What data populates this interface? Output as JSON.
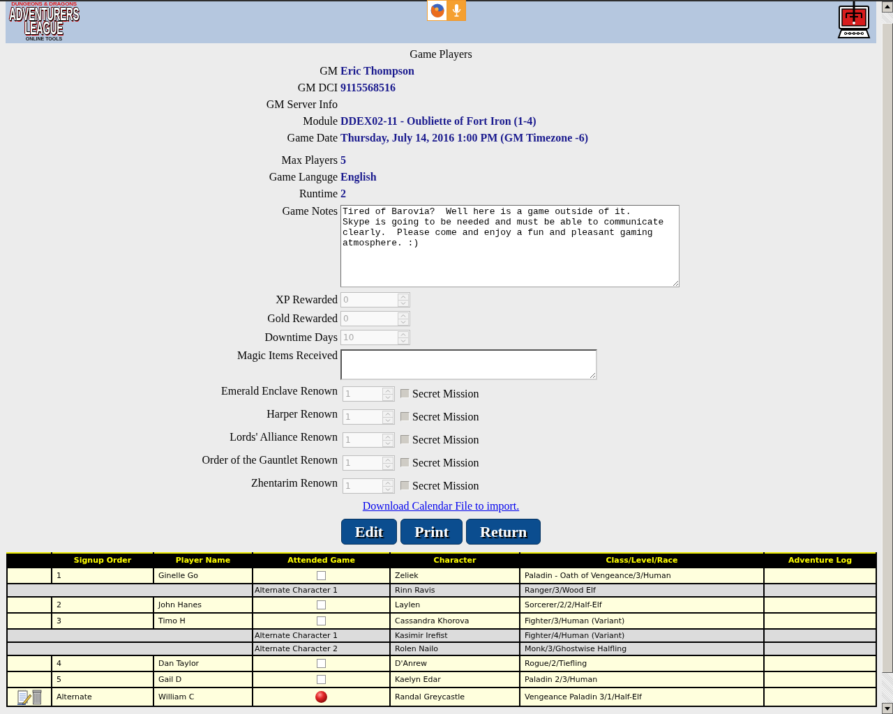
{
  "header": {
    "logo": {
      "brand": "DUNGEONS & DRAGONS",
      "title_line_1": "ADVENTURERS",
      "title_line_2": "LEAGUE",
      "tagline": "ONLINE TOOLS"
    }
  },
  "page_title": "Game Players",
  "details": [
    {
      "label": "GM",
      "value": "Eric Thompson"
    },
    {
      "label": "GM DCI",
      "value": "9115568516"
    },
    {
      "label": "GM Server Info"
    },
    {
      "label": "Module",
      "value": "DDEX02-11 - Oubliette of Fort Iron (1-4)"
    },
    {
      "label": "Game Date",
      "value": "Thursday, July 14, 2016 1:00 PM (GM Timezone -6)"
    }
  ],
  "game_info": [
    {
      "label": "Max Players",
      "value": "5"
    },
    {
      "label": "Game Languge",
      "value": "English"
    },
    {
      "label": "Runtime",
      "value": "2"
    }
  ],
  "game_notes": {
    "label": "Game Notes",
    "value": "Tired of Barovia?  Well here is a game outside of it.\nSkype is going to be needed and must be able to communicate\nclearly.  Please come and enjoy a fun and pleasant gaming\natmosphere. :)"
  },
  "rewards": [
    {
      "label": "XP Rewarded",
      "value": "0",
      "disabled": true
    },
    {
      "label": "Gold Rewarded",
      "value": "0",
      "disabled": true
    },
    {
      "label": "Downtime Days",
      "value": "10",
      "disabled": true
    }
  ],
  "magic_items": {
    "label": "Magic Items Received"
  },
  "renown": [
    {
      "label": "Emerald Enclave Renown",
      "value": "1",
      "disabled": true,
      "secret_mission": {
        "label": "Secret Mission",
        "checked": false
      }
    },
    {
      "label": "Harper Renown",
      "value": "1",
      "disabled": true,
      "secret_mission": {
        "label": "Secret Mission",
        "checked": false
      }
    },
    {
      "label": "Lords' Alliance Renown",
      "value": "1",
      "disabled": true,
      "secret_mission": {
        "label": "Secret Mission",
        "checked": false
      }
    },
    {
      "label": "Order of the Gauntlet Renown",
      "value": "1",
      "disabled": true,
      "secret_mission": {
        "label": "Secret Mission",
        "checked": false
      }
    },
    {
      "label": "Zhentarim Renown",
      "value": "1",
      "disabled": true,
      "secret_mission": {
        "label": "Secret Mission",
        "checked": false
      }
    }
  ],
  "calendar_link": "Download Calendar File to import.",
  "buttons": [
    {
      "label": "Edit"
    },
    {
      "label": "Print"
    },
    {
      "label": "Return"
    }
  ],
  "table": {
    "columns": [
      "Signup Order",
      "Player Name",
      "Attended Game",
      "Character",
      "Class/Level/Race",
      "Adventure Log"
    ],
    "rows": [
      {
        "kind": "player",
        "editable": false,
        "signup_order": "1",
        "player_name": "Ginelle Go",
        "attended": {
          "kind": "checkbox",
          "checked": false
        },
        "character": "Zeliek",
        "class_level_race": "Paladin - Oath of Vengeance/3/Human"
      },
      {
        "kind": "alternate",
        "label": "Alternate Character 1",
        "character": "Rinn Ravis",
        "class_level_race": "Ranger/3/Wood Elf"
      },
      {
        "kind": "player",
        "editable": false,
        "signup_order": "2",
        "player_name": "John Hanes",
        "attended": {
          "kind": "checkbox",
          "checked": false
        },
        "character": "Laylen",
        "class_level_race": "Sorcerer/2/2/Half-Elf"
      },
      {
        "kind": "player",
        "editable": false,
        "signup_order": "3",
        "player_name": "Timo H",
        "attended": {
          "kind": "checkbox",
          "checked": false
        },
        "character": "Cassandra Khorova",
        "class_level_race": "Fighter/3/Human (Variant)"
      },
      {
        "kind": "alternate",
        "label": "Alternate Character 1",
        "character": "Kasimir Irefist",
        "class_level_race": "Fighter/4/Human (Variant)"
      },
      {
        "kind": "alternate",
        "label": "Alternate Character 2",
        "character": "Rolen Nailo",
        "class_level_race": "Monk/3/Ghostwise Halfling"
      },
      {
        "kind": "player",
        "editable": false,
        "signup_order": "4",
        "player_name": "Dan Taylor",
        "attended": {
          "kind": "checkbox",
          "checked": false
        },
        "character": "D'Anrew",
        "class_level_race": "Rogue/2/Tiefling"
      },
      {
        "kind": "player",
        "editable": false,
        "signup_order": "5",
        "player_name": "Gail D",
        "attended": {
          "kind": "checkbox",
          "checked": false
        },
        "character": "Kaelyn Edar",
        "class_level_race": "Paladin 2/3/Human"
      },
      {
        "kind": "player",
        "editable": true,
        "signup_order": "Alternate",
        "player_name": "William C",
        "attended": {
          "kind": "ball"
        },
        "character": "Randal Greycastle",
        "class_level_race": "Vengeance Paladin 3/1/Half-Elf"
      }
    ]
  }
}
